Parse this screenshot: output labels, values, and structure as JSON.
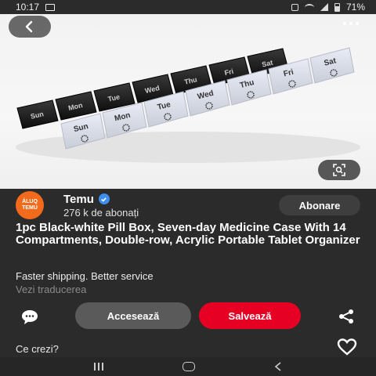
{
  "status_bar": {
    "time": "10:17",
    "battery": "71%"
  },
  "pill_box": {
    "days": [
      "Sun",
      "Mon",
      "Tue",
      "Wed",
      "Thu",
      "Fri",
      "Sat"
    ]
  },
  "channel": {
    "logo_line1": "ÁLUQ",
    "logo_line2": "TEMU",
    "name": "Temu",
    "subscribers": "276 k de abonați",
    "subscribe_label": "Abonare"
  },
  "pin": {
    "title": "1pc Black-white Pill Box, Seven-day Medicine Case With 14 Compartments, Double-row, Acrylic Portable Tablet Organizer",
    "tagline": "Faster shipping. Better service",
    "translate_label": "Vezi traducerea"
  },
  "actions": {
    "visit_label": "Accesează",
    "save_label": "Salvează"
  },
  "comments": {
    "prompt": "Ce crezi?"
  },
  "colors": {
    "save_red": "#e60023",
    "brand_orange": "#f26a1b",
    "verified_blue": "#3d8ef0"
  }
}
